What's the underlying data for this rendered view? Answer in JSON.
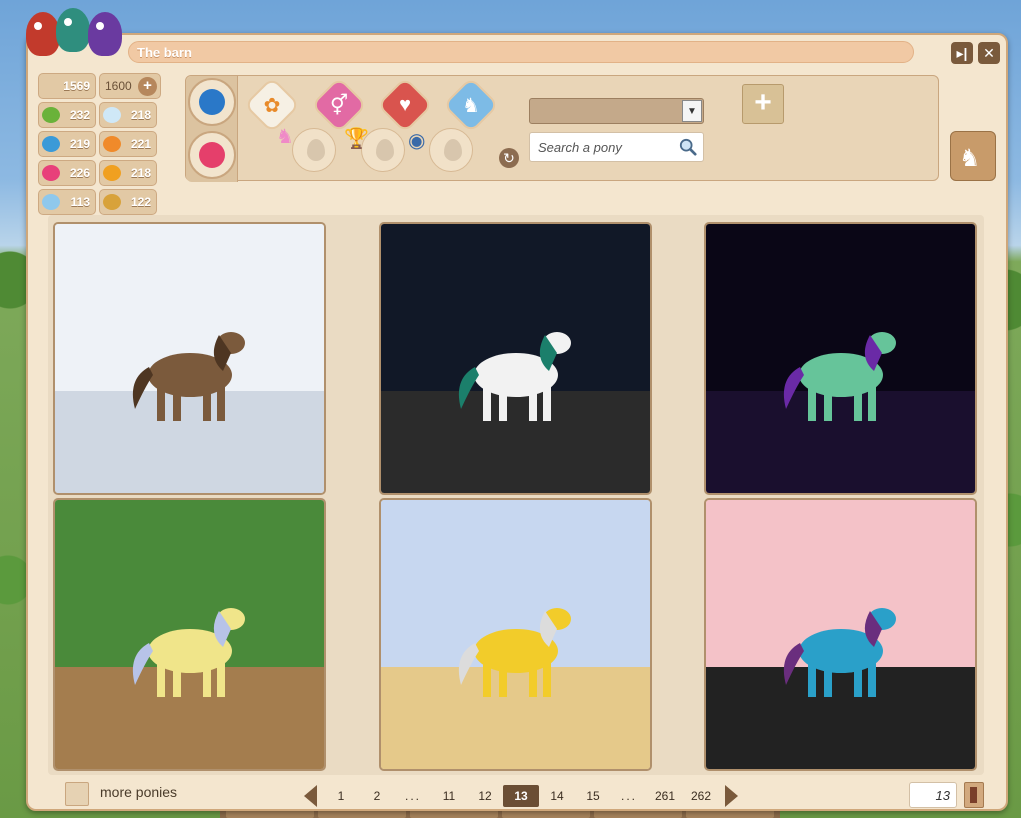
{
  "window": {
    "title": "The barn"
  },
  "stats": {
    "capacity_used": "1569",
    "capacity_total": "1600",
    "items": [
      {
        "icon": "apple-icon",
        "value": "232",
        "color": "#6ab23a"
      },
      {
        "icon": "cloud-icon",
        "value": "218",
        "color": "#cfe8f7"
      },
      {
        "icon": "paw-blue-icon",
        "value": "219",
        "color": "#3a9ad8"
      },
      {
        "icon": "shell-icon",
        "value": "221",
        "color": "#f08a2a"
      },
      {
        "icon": "heart-icon",
        "value": "226",
        "color": "#e8407a"
      },
      {
        "icon": "paw-icon",
        "value": "218",
        "color": "#f0a020"
      },
      {
        "icon": "feather-icon",
        "value": "113",
        "color": "#8fc8ec"
      },
      {
        "icon": "horseshoe-icon",
        "value": "122",
        "color": "#d8a23a"
      }
    ]
  },
  "search": {
    "placeholder": "Search a pony",
    "value": ""
  },
  "select": {
    "value": ""
  },
  "ponies": [
    {
      "name": "pony-card-1",
      "sky": "#eef2f7",
      "ground": "#cfd7e2",
      "body": "#7b5a3c",
      "mane": "#4e3622"
    },
    {
      "name": "pony-card-2",
      "sky": "#111827",
      "ground": "#2b2b2b",
      "body": "#f2f2f2",
      "mane": "#1b7f6b"
    },
    {
      "name": "pony-card-3",
      "sky": "#0a0616",
      "ground": "#1a0f2e",
      "body": "#66c49a",
      "mane": "#6a2aa6"
    },
    {
      "name": "pony-card-4",
      "sky": "#4a8a3a",
      "ground": "#a47d4e",
      "body": "#f0e58a",
      "mane": "#b7c3e8"
    },
    {
      "name": "pony-card-5",
      "sky": "#c7d7f0",
      "ground": "#e5c98a",
      "body": "#f2cc2a",
      "mane": "#dcdcdc"
    },
    {
      "name": "pony-card-6",
      "sky": "#f4c2c8",
      "ground": "#222222",
      "body": "#2aa0c9",
      "mane": "#6a2e7e"
    }
  ],
  "bottom": {
    "more_label": "more ponies",
    "pages": [
      "1",
      "2",
      "...",
      "11",
      "12",
      "13",
      "14",
      "15",
      "...",
      "261",
      "262"
    ],
    "current_page": "13",
    "page_input": "13"
  }
}
